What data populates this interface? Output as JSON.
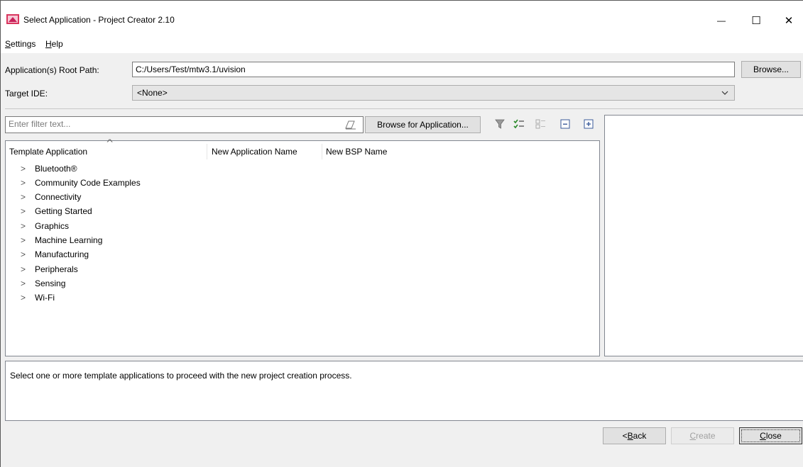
{
  "window": {
    "title": "Select Application - Project Creator 2.10",
    "minimize_glyph": "—",
    "maximize_glyph": "☐",
    "close_glyph": "✕"
  },
  "menu": {
    "settings": {
      "pre": "",
      "key": "S",
      "post": "ettings"
    },
    "help": {
      "pre": "",
      "key": "H",
      "post": "elp"
    }
  },
  "root_path": {
    "label": "Application(s) Root Path:",
    "value": "C:/Users/Test/mtw3.1/uvision",
    "browse_label": "Browse..."
  },
  "target_ide": {
    "label": "Target IDE:",
    "selected": "<None>"
  },
  "filter": {
    "placeholder": "Enter filter text...",
    "browse_app_label": "Browse for Application..."
  },
  "toolbar_icons": [
    "filter-icon",
    "select-all-icon",
    "deselect-all-icon",
    "collapse-all-icon",
    "expand-all-icon"
  ],
  "table": {
    "columns": [
      "Template Application",
      "New Application Name",
      "New BSP Name"
    ],
    "sort_indicator": "^",
    "rows": [
      {
        "label": "Bluetooth®"
      },
      {
        "label": "Community Code Examples"
      },
      {
        "label": "Connectivity"
      },
      {
        "label": "Getting Started"
      },
      {
        "label": "Graphics"
      },
      {
        "label": "Machine Learning"
      },
      {
        "label": "Manufacturing"
      },
      {
        "label": "Peripherals"
      },
      {
        "label": "Sensing"
      },
      {
        "label": "Wi-Fi"
      }
    ],
    "expand_glyph": ">"
  },
  "description": "Select one or more template applications to proceed with the new project creation process.",
  "buttons": {
    "back": {
      "pre": "< ",
      "key": "B",
      "post": "ack"
    },
    "create": {
      "pre": "",
      "key": "C",
      "post": "reate"
    },
    "close": {
      "pre": "",
      "key": "C",
      "post": "lose"
    }
  },
  "colors": {
    "window_bg": "#f0f0f0",
    "title_bg": "#ffffff",
    "panel_border": "#828790",
    "disabled_text": "#a0a0a0"
  }
}
